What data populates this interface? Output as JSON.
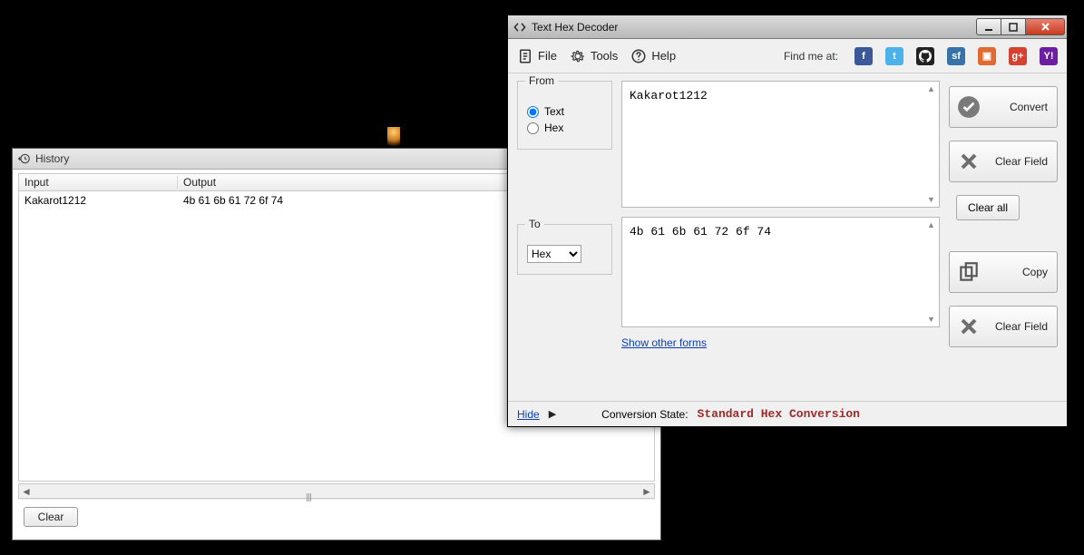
{
  "history_window": {
    "title": "History",
    "columns": {
      "input": "Input",
      "output": "Output"
    },
    "rows": [
      {
        "input": "Kakarot1212",
        "output": "4b 61 6b 61 72 6f 74"
      }
    ],
    "clear_button": "Clear"
  },
  "main_window": {
    "title": "Text Hex Decoder",
    "menu": {
      "file": "File",
      "tools": "Tools",
      "help": "Help",
      "find_me_at": "Find me at:"
    },
    "from": {
      "group_label": "From",
      "option_text": "Text",
      "option_hex": "Hex",
      "selected": "Text",
      "value": "Kakarot1212"
    },
    "to": {
      "group_label": "To",
      "selected_format": "Hex",
      "value": "4b 61 6b 61 72 6f 74"
    },
    "buttons": {
      "convert": "Convert",
      "clear_field_top": "Clear Field",
      "clear_all": "Clear all",
      "copy": "Copy",
      "clear_field_bottom": "Clear Field"
    },
    "show_other_forms": "Show other forms",
    "hide_link": "Hide",
    "conversion_state_label": "Conversion State:",
    "conversion_state_value": "Standard Hex Conversion"
  }
}
